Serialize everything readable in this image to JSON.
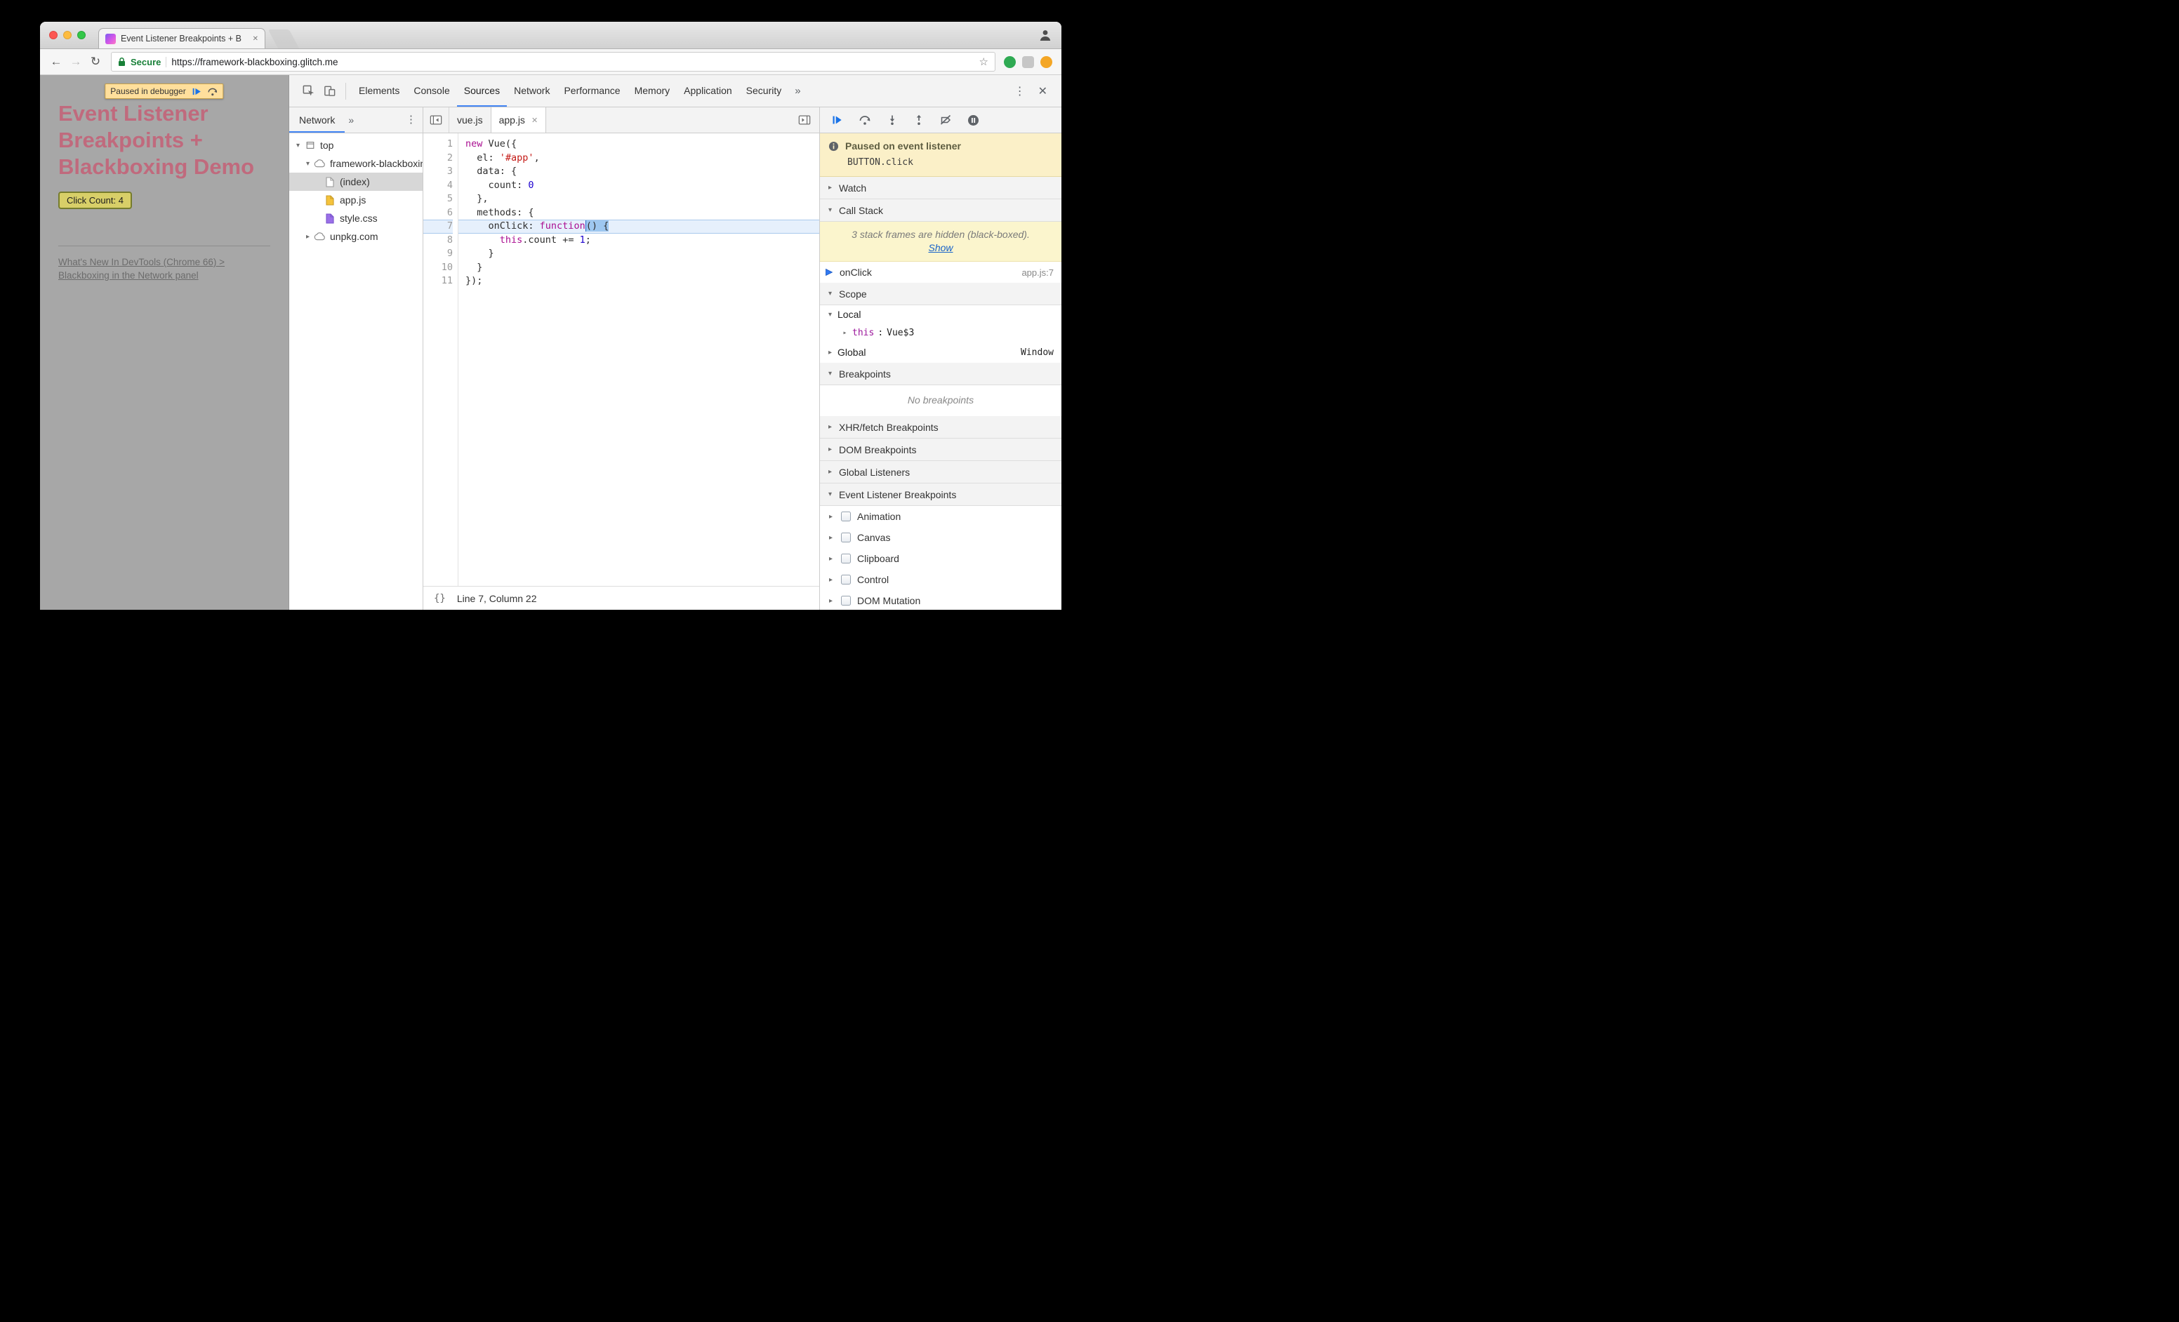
{
  "window": {
    "title": "Event Listener Breakpoints + B"
  },
  "browser": {
    "secure_label": "Secure",
    "url": "https://framework-blackboxing.glitch.me"
  },
  "icons": {
    "back": "←",
    "forward": "→",
    "reload": "↻",
    "star": "☆",
    "more": "»",
    "menu": "⋮",
    "close": "✕",
    "tab_close": "✕",
    "tri_open": "▾",
    "tri_closed": "▸",
    "braces": "{}"
  },
  "page": {
    "paused_banner": "Paused in debugger",
    "heading": "Event Listener Breakpoints + Blackboxing Demo",
    "button_label": "Click Count: 4",
    "link_line1": "What's New In DevTools (Chrome 66) >",
    "link_line2": "Blackboxing in the Network panel"
  },
  "devtools": {
    "tabs": [
      "Elements",
      "Console",
      "Sources",
      "Network",
      "Performance",
      "Memory",
      "Application",
      "Security"
    ],
    "active_tab": "Sources",
    "navigator": {
      "tab_label": "Network",
      "tree": [
        {
          "label": "top",
          "icon": "frame-icon",
          "expanded": true,
          "depth": 0
        },
        {
          "label": "framework-blackboxing.glitch.me",
          "icon": "cloud-icon",
          "expanded": true,
          "depth": 1
        },
        {
          "label": "(index)",
          "icon": "document-icon",
          "depth": 2,
          "selected": true
        },
        {
          "label": "app.js",
          "icon": "script-icon",
          "depth": 2
        },
        {
          "label": "style.css",
          "icon": "stylesheet-icon",
          "depth": 2
        },
        {
          "label": "unpkg.com",
          "icon": "cloud-icon",
          "expanded": false,
          "depth": 1
        }
      ]
    },
    "editor": {
      "tabs": [
        "vue.js",
        "app.js"
      ],
      "active_tab": "app.js",
      "status": "Line 7, Column 22",
      "code": {
        "lines": [
          {
            "n": 1,
            "tokens": [
              {
                "t": "new",
                "c": "kw"
              },
              {
                "t": " Vue({"
              }
            ]
          },
          {
            "n": 2,
            "tokens": [
              {
                "t": "  el: "
              },
              {
                "t": "'#app'",
                "c": "str"
              },
              {
                "t": ","
              }
            ]
          },
          {
            "n": 3,
            "tokens": [
              {
                "t": "  data: {"
              }
            ]
          },
          {
            "n": 4,
            "tokens": [
              {
                "t": "    count: "
              },
              {
                "t": "0",
                "c": "num"
              }
            ]
          },
          {
            "n": 5,
            "tokens": [
              {
                "t": "  },"
              }
            ]
          },
          {
            "n": 6,
            "tokens": [
              {
                "t": "  methods: {"
              }
            ]
          },
          {
            "n": 7,
            "exec": true,
            "tokens": [
              {
                "t": "    onClick: "
              },
              {
                "t": "function",
                "c": "kw"
              },
              {
                "t": "() {",
                "c": "sel"
              }
            ]
          },
          {
            "n": 8,
            "tokens": [
              {
                "t": "      "
              },
              {
                "t": "this",
                "c": "kw"
              },
              {
                "t": ".count += "
              },
              {
                "t": "1",
                "c": "num"
              },
              {
                "t": ";"
              }
            ]
          },
          {
            "n": 9,
            "tokens": [
              {
                "t": "    }"
              }
            ]
          },
          {
            "n": 10,
            "tokens": [
              {
                "t": "  }"
              }
            ]
          },
          {
            "n": 11,
            "tokens": [
              {
                "t": "});"
              }
            ]
          }
        ]
      }
    },
    "debugger": {
      "paused_title": "Paused on event listener",
      "paused_detail": "BUTTON.click",
      "watch_label": "Watch",
      "call_stack_label": "Call Stack",
      "blackbox_notice": "3 stack frames are hidden (black-boxed).",
      "blackbox_show": "Show",
      "frame": {
        "name": "onClick",
        "location": "app.js:7"
      },
      "scope_label": "Scope",
      "local_label": "Local",
      "this_key": "this",
      "this_sep": ": ",
      "this_value": "Vue$3",
      "global_label": "Global",
      "global_value": "Window",
      "breakpoints_label": "Breakpoints",
      "no_breakpoints": "No breakpoints",
      "xhr_label": "XHR/fetch Breakpoints",
      "dom_label": "DOM Breakpoints",
      "global_listeners_label": "Global Listeners",
      "event_listener_label": "Event Listener Breakpoints",
      "categories": [
        "Animation",
        "Canvas",
        "Clipboard",
        "Control",
        "DOM Mutation"
      ]
    }
  },
  "colors": {
    "accent_blue": "#4285f4",
    "page_dim_bg": "#a7a7a7",
    "heading_pink": "#c06a7d",
    "paused_banner_bg": "#ffdf9c",
    "sidebar_paused_bg": "#fbf0c8",
    "blackbox_bg": "#fbf5cd",
    "exec_line_bg": "#e6f0fc",
    "selection_bg": "#9ec7f0",
    "syntax_keyword": "#aa0d91",
    "syntax_string": "#c41a16",
    "syntax_number": "#1c00cf"
  }
}
